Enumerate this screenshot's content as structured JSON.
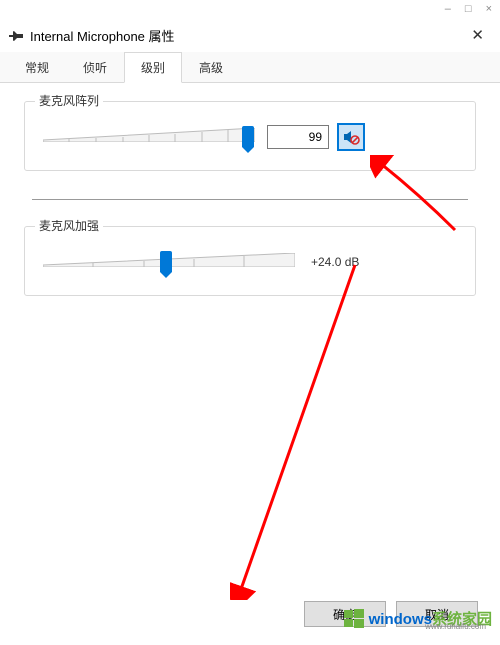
{
  "browser_controls": {
    "minimize": "–",
    "maximize": "□",
    "close": "×"
  },
  "window": {
    "title": "Internal Microphone 属性",
    "close": "✕"
  },
  "tabs": [
    "常规",
    "侦听",
    "级别",
    "高级"
  ],
  "active_tab_index": 2,
  "mic_array": {
    "label": "麦克风阵列",
    "value": "99",
    "slider_percent": 95,
    "muted": true
  },
  "mic_boost": {
    "label": "麦克风加强",
    "value": "+24.0 dB",
    "slider_percent": 49
  },
  "buttons": {
    "ok": "确定",
    "cancel": "取消"
  },
  "watermark": {
    "text_a": "windows",
    "text_b": "系统家园",
    "sub": "www.ruhaifu.com"
  }
}
